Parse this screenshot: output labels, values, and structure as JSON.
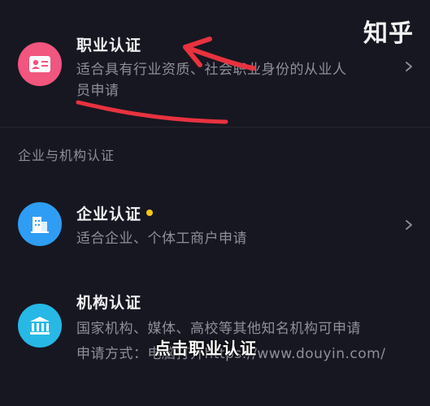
{
  "watermark": "知乎",
  "professional": {
    "title": "职业认证",
    "desc_line1": "适合具有行业资质、社会职业身份的从业人",
    "desc_line2": "员申请"
  },
  "section_label": "企业与机构认证",
  "enterprise": {
    "title": "企业认证",
    "desc": "适合企业、个体工商户申请"
  },
  "institution": {
    "title": "机构认证",
    "desc": "国家机构、媒体、高校等其他知名机构可申请",
    "apply_line": "申请方式：电脑打开https://www.douyin.com/"
  },
  "caption": "点击职业认证",
  "colors": {
    "professional_icon_bg": "#f0567e",
    "enterprise_icon_bg": "#2f9df4",
    "institution_icon_bg": "#27b8e6",
    "notification_dot": "#f5c518",
    "annotation_red": "#e8323f"
  }
}
